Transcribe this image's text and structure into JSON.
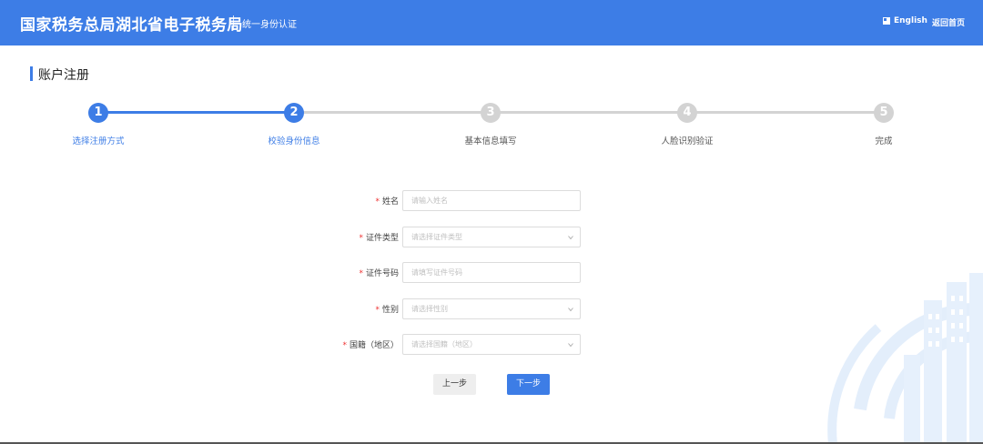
{
  "header": {
    "brand": "国家税务总局湖北省电子税务局",
    "subtitle": "统一身份认证",
    "language_link": "English",
    "home_link": "返回首页"
  },
  "page": {
    "title": "账户注册"
  },
  "steps": [
    {
      "number": "1",
      "label": "选择注册方式",
      "status": "done"
    },
    {
      "number": "2",
      "label": "校验身份信息",
      "status": "current"
    },
    {
      "number": "3",
      "label": "基本信息填写",
      "status": "todo"
    },
    {
      "number": "4",
      "label": "人脸识别验证",
      "status": "todo"
    },
    {
      "number": "5",
      "label": "完成",
      "status": "todo"
    }
  ],
  "form": {
    "required_mark": "*",
    "name": {
      "label": "姓名",
      "placeholder": "请输入姓名",
      "value": ""
    },
    "id_type": {
      "label": "证件类型",
      "placeholder": "请选择证件类型",
      "value": ""
    },
    "id_number": {
      "label": "证件号码",
      "placeholder": "请填写证件号码",
      "value": ""
    },
    "gender": {
      "label": "性别",
      "placeholder": "请选择性别",
      "value": ""
    },
    "nationality": {
      "label": "国籍（地区）",
      "placeholder": "请选择国籍（地区）",
      "value": ""
    }
  },
  "buttons": {
    "prev": "上一步",
    "next": "下一步"
  },
  "colors": {
    "primary": "#3d7de6",
    "inactive_step": "#d3d3d3",
    "required": "#e33333",
    "deco": "#e3eefb"
  }
}
